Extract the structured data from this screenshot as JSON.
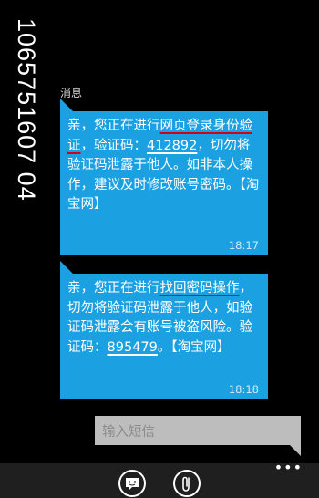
{
  "sender": "1065751607 04",
  "section_label": "消息",
  "messages": [
    {
      "segments": [
        {
          "t": "亲，您正在进行",
          "s": "plain"
        },
        {
          "t": "网页登录身份验证",
          "s": "hl"
        },
        {
          "t": "，验证码：",
          "s": "plain"
        },
        {
          "t": "412892",
          "s": "code"
        },
        {
          "t": "，切勿将验证码泄露于他人。如非本人操作，建议及时修改账号密码。【淘宝网】",
          "s": "plain"
        }
      ],
      "time": "18:17"
    },
    {
      "segments": [
        {
          "t": "亲，您正在进行",
          "s": "plain"
        },
        {
          "t": "找回密码操作",
          "s": "hl"
        },
        {
          "t": "，切勿将验证码泄露于他人，如验证码泄露会有账号被盗风险。验证码：",
          "s": "plain"
        },
        {
          "t": "895479",
          "s": "code"
        },
        {
          "t": "。【淘宝网】",
          "s": "plain"
        }
      ],
      "time": "18:18"
    }
  ],
  "compose": {
    "placeholder": "输入短信"
  },
  "appbar": {
    "more": "•••",
    "buttons": [
      "emoji-icon",
      "attach-icon"
    ]
  },
  "colors": {
    "bubble": "#1ba1e2",
    "highlight_underline": "#d0021b",
    "compose_bg": "#bdbdbd",
    "appbar_bg": "#1f1f1f"
  }
}
